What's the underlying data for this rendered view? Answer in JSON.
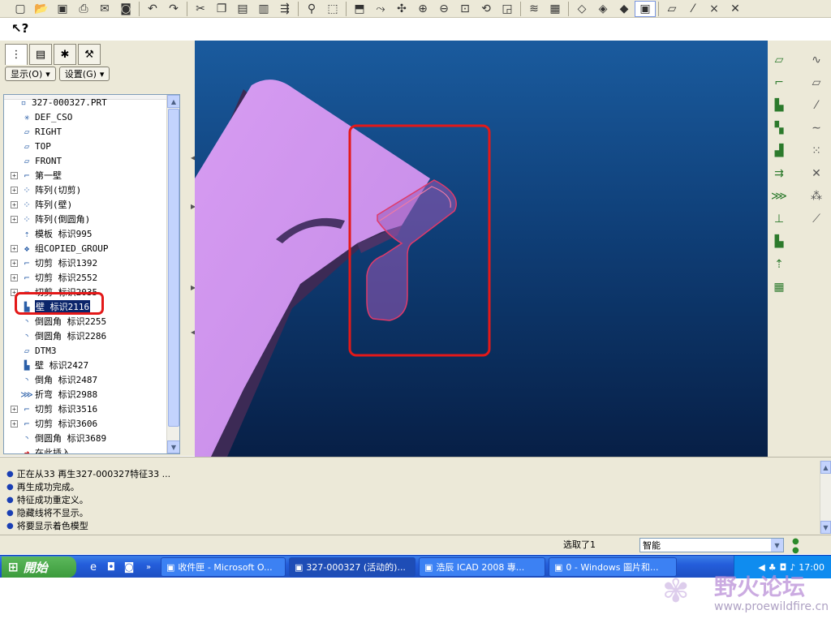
{
  "toolbar": {
    "icons": [
      "new-icon",
      "open-icon",
      "save-icon",
      "print-icon",
      "email-icon",
      "disk-icon",
      "undo-icon",
      "redo-icon",
      "cut-icon",
      "copy-icon",
      "paste-icon",
      "paste-special-icon",
      "regenerate-icon",
      "find-icon",
      "select-box-icon",
      "repaint-icon",
      "orient-icon",
      "spin-center-icon",
      "zoom-in-icon",
      "zoom-out-icon",
      "refit-icon",
      "reorient-icon",
      "saved-views-icon",
      "layers-icon",
      "model-display-icon",
      "wireframe-icon",
      "hidden-line-icon",
      "no-hidden-icon",
      "shading-icon",
      "datum-plane-display-icon",
      "datum-axis-display-icon",
      "datum-point-display-icon",
      "coord-sys-display-icon"
    ]
  },
  "select_tool": {
    "label": "k?"
  },
  "left_panel": {
    "tabs": [
      "model-tree-tab",
      "layer-tree-tab",
      "favorites-tab",
      "connections-tab"
    ],
    "show_button": "显示(O)",
    "settings_button": "设置(G)",
    "tree": [
      {
        "label": "327-000327.PRT",
        "icon": "part-icon",
        "expand": "none"
      },
      {
        "label": "DEF_CSO",
        "icon": "coordsys-icon",
        "expand": "none"
      },
      {
        "label": "RIGHT",
        "icon": "datum-plane-icon",
        "expand": "none"
      },
      {
        "label": "TOP",
        "icon": "datum-plane-icon",
        "expand": "none"
      },
      {
        "label": "FRONT",
        "icon": "datum-plane-icon",
        "expand": "none"
      },
      {
        "label": "第一壁",
        "icon": "wall-icon",
        "expand": "+"
      },
      {
        "label": "阵列(切剪)",
        "icon": "pattern-icon",
        "expand": "+"
      },
      {
        "label": "阵列(壁)",
        "icon": "pattern-icon",
        "expand": "+"
      },
      {
        "label": "阵列(倒圆角)",
        "icon": "pattern-icon",
        "expand": "+"
      },
      {
        "label": "模板 标识995",
        "icon": "form-icon",
        "expand": "none"
      },
      {
        "label": "组COPIED_GROUP",
        "icon": "group-icon",
        "expand": "+"
      },
      {
        "label": "切剪 标识1392",
        "icon": "cut-feature-icon",
        "expand": "+"
      },
      {
        "label": "切剪 标识2552",
        "icon": "cut-feature-icon",
        "expand": "+"
      },
      {
        "label": "切剪 标识2035",
        "icon": "cut-feature-icon",
        "expand": "+"
      },
      {
        "label": "壁 标识2116",
        "icon": "flange-wall-icon",
        "expand": "none",
        "highlighted": true
      },
      {
        "label": "倒圆角 标识2255",
        "icon": "round-icon",
        "expand": "none"
      },
      {
        "label": "倒圆角 标识2286",
        "icon": "round-icon",
        "expand": "none"
      },
      {
        "label": "DTM3",
        "icon": "datum-plane-icon",
        "expand": "none"
      },
      {
        "label": "壁 标识2427",
        "icon": "flange-wall-icon",
        "expand": "none"
      },
      {
        "label": "倒角 标识2487",
        "icon": "round-icon",
        "expand": "none"
      },
      {
        "label": "折弯 标识2988",
        "icon": "bend-icon",
        "expand": "none"
      },
      {
        "label": "切剪 标识3516",
        "icon": "cut-feature-icon",
        "expand": "+"
      },
      {
        "label": "切剪 标识3606",
        "icon": "cut-feature-icon",
        "expand": "+"
      },
      {
        "label": "倒圆角 标识3689",
        "icon": "round-icon",
        "expand": "none"
      },
      {
        "label": "在此插入",
        "icon": "insert-arrow-icon",
        "expand": "none"
      }
    ]
  },
  "right_toolbar": {
    "icons": [
      "datum-plane-tool-icon",
      "sketch-curve-icon",
      "flat-wall-icon",
      "datum-plane-tool-2-icon",
      "flange-wall-icon",
      "datum-axis-tool-icon",
      "extrude-wall-icon",
      "curve-tool-icon",
      "unbend-icon",
      "datum-point-icon",
      "bend-back-icon",
      "coord-sys-tool-icon",
      "form-icon",
      "analysis-icon",
      "bend-tool-icon",
      "edge-rip-icon",
      "corner-relief-icon",
      "convert-icon",
      "flat-pattern-icon"
    ]
  },
  "messages": [
    "正在从33 再生327-000327特征33 ...",
    "再生成功完成。",
    "特征成功重定义。",
    "隐藏线将不显示。",
    "将要显示着色模型"
  ],
  "status": {
    "selection_count": "选取了1",
    "filter_value": "智能"
  },
  "taskbar": {
    "start_label": "開始",
    "quicklaunch": [
      "ie-icon",
      "outlook-icon",
      "media-icon"
    ],
    "buttons": [
      {
        "label": "收件匣 - Microsoft O...",
        "icon": "outlook-icon"
      },
      {
        "label": "327-000327 (活动的)...",
        "icon": "proe-icon"
      },
      {
        "label": "浩辰 ICAD 2008 專...",
        "icon": "icad-icon"
      },
      {
        "label": "0 - Windows 圖片和...",
        "icon": "image-viewer-icon"
      }
    ],
    "clock": "17:00"
  },
  "watermark": {
    "site_name": "野火论坛",
    "url": "www.proewildfire.cn"
  }
}
